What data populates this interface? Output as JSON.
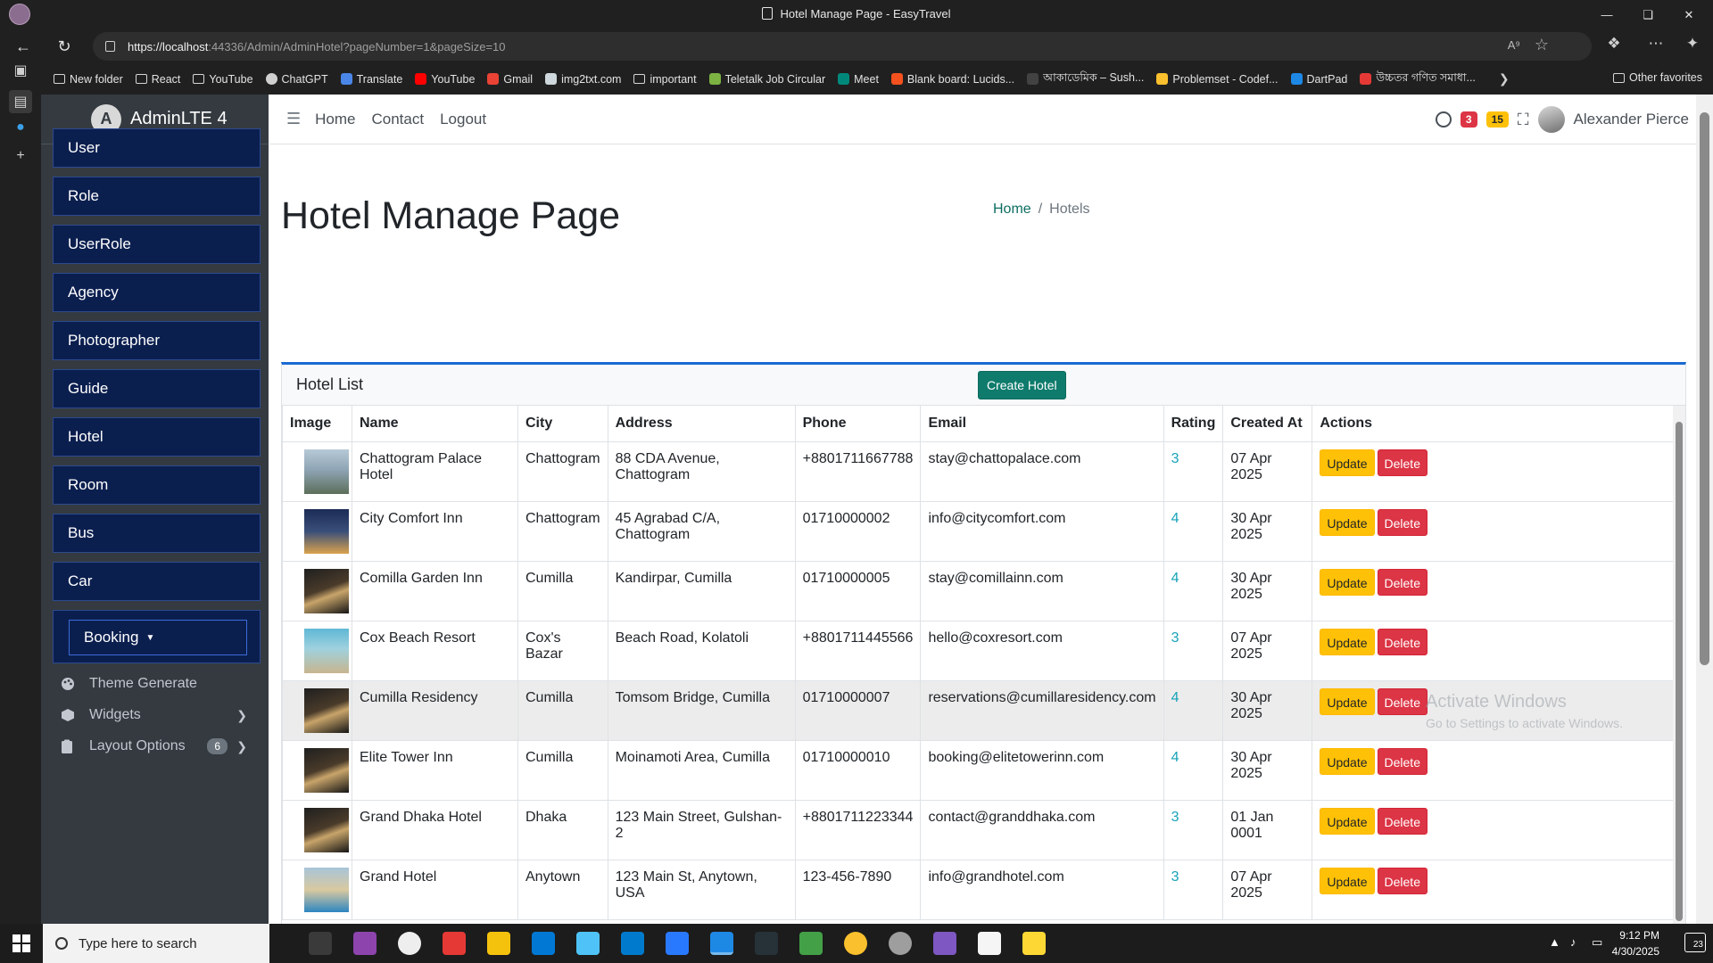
{
  "browser": {
    "window_title": "Hotel Manage Page - EasyTravel",
    "url_host": "https://localhost",
    "url_rest": ":44336/Admin/AdminHotel?pageNumber=1&pageSize=10",
    "bookmarks": [
      {
        "label": "New folder",
        "icon": "folder-icon"
      },
      {
        "label": "React",
        "icon": "folder-icon"
      },
      {
        "label": "YouTube",
        "icon": "folder-icon"
      },
      {
        "label": "ChatGPT",
        "icon": "chatgpt-icon"
      },
      {
        "label": "Translate",
        "icon": "translate-icon"
      },
      {
        "label": "YouTube",
        "icon": "youtube-icon"
      },
      {
        "label": "Gmail",
        "icon": "gmail-icon"
      },
      {
        "label": "img2txt.com",
        "icon": "page-icon"
      },
      {
        "label": "important",
        "icon": "folder-icon"
      },
      {
        "label": "Teletalk Job Circular",
        "icon": "teletalk-icon"
      },
      {
        "label": "Meet",
        "icon": "meet-icon"
      },
      {
        "label": "Blank board: Lucids...",
        "icon": "lucid-icon"
      },
      {
        "label": "আকাডেমিক – Sush...",
        "icon": "page-icon"
      },
      {
        "label": "Problemset - Codef...",
        "icon": "codeforces-icon"
      },
      {
        "label": "DartPad",
        "icon": "dartpad-icon"
      },
      {
        "label": "উচ্চতর গণিত সমাধা...",
        "icon": "pdf-icon"
      }
    ],
    "other_favorites": "Other favorites"
  },
  "sidebar": {
    "brand": "AdminLTE 4",
    "items": [
      "User",
      "Role",
      "UserRole",
      "Agency",
      "Photographer",
      "Guide",
      "Hotel",
      "Room",
      "Bus",
      "Car"
    ],
    "booking": "Booking",
    "sub_items": [
      {
        "label": "Theme Generate",
        "icon": "palette-icon"
      },
      {
        "label": "Widgets",
        "icon": "box-icon"
      },
      {
        "label": "Layout Options",
        "icon": "clipboard-icon",
        "badge": "6"
      }
    ]
  },
  "topnav": {
    "links": [
      "Home",
      "Contact",
      "Logout"
    ],
    "badge_red": "3",
    "badge_yellow": "15",
    "user_name": "Alexander Pierce"
  },
  "page": {
    "title": "Hotel Manage Page",
    "breadcrumb_home": "Home",
    "breadcrumb_current": "Hotels"
  },
  "card": {
    "title": "Hotel List",
    "create_label": "Create Hotel",
    "columns": [
      "Image",
      "Name",
      "City",
      "Address",
      "Phone",
      "Email",
      "Rating",
      "Created At",
      "Actions"
    ],
    "update_label": "Update",
    "delete_label": "Delete",
    "rows": [
      {
        "name": "Chattogram Palace Hotel",
        "city": "Chattogram",
        "address": "88 CDA Avenue, Chattogram",
        "phone": "+8801711667788",
        "email": "stay@chattopalace.com",
        "rating": "3",
        "created": "07 Apr 2025",
        "thumb": "tower"
      },
      {
        "name": "City Comfort Inn",
        "city": "Chattogram",
        "address": "45 Agrabad C/A, Chattogram",
        "phone": "01710000002",
        "email": "info@citycomfort.com",
        "rating": "4",
        "created": "30 Apr 2025",
        "thumb": "night"
      },
      {
        "name": "Comilla Garden Inn",
        "city": "Cumilla",
        "address": "Kandirpar, Cumilla",
        "phone": "01710000005",
        "email": "stay@comillainn.com",
        "rating": "4",
        "created": "30 Apr 2025",
        "thumb": "dark"
      },
      {
        "name": "Cox Beach Resort",
        "city": "Cox's Bazar",
        "address": "Beach Road, Kolatoli",
        "phone": "+8801711445566",
        "email": "hello@coxresort.com",
        "rating": "3",
        "created": "07 Apr 2025",
        "thumb": "beach"
      },
      {
        "name": "Cumilla Residency",
        "city": "Cumilla",
        "address": "Tomsom Bridge, Cumilla",
        "phone": "01710000007",
        "email": "reservations@cumillaresidency.com",
        "rating": "4",
        "created": "30 Apr 2025",
        "thumb": "dark"
      },
      {
        "name": "Elite Tower Inn",
        "city": "Cumilla",
        "address": "Moinamoti Area, Cumilla",
        "phone": "01710000010",
        "email": "booking@elitetowerinn.com",
        "rating": "4",
        "created": "30 Apr 2025",
        "thumb": "dark"
      },
      {
        "name": "Grand Dhaka Hotel",
        "city": "Dhaka",
        "address": "123 Main Street, Gulshan-2",
        "phone": "+8801711223344",
        "email": "contact@granddhaka.com",
        "rating": "3",
        "created": "01 Jan 0001",
        "thumb": "dark"
      },
      {
        "name": "Grand Hotel",
        "city": "Anytown",
        "address": "123 Main St, Anytown, USA",
        "phone": "123-456-7890",
        "email": "info@grandhotel.com",
        "rating": "3",
        "created": "07 Apr 2025",
        "thumb": "pool"
      }
    ]
  },
  "watermark": {
    "line1": "Activate Windows",
    "line2": "Go to Settings to activate Windows."
  },
  "taskbar": {
    "search_placeholder": "Type here to search",
    "time": "9:12 PM",
    "date": "4/30/2025",
    "notif_count": "23"
  },
  "colors": {
    "sidebar_bg": "#343a40",
    "menu_btn": "#0b1f4f",
    "accent_teal": "#0f7b6c",
    "update_btn": "#ffc107",
    "delete_btn": "#dc3545",
    "rating_link": "#17a2b8",
    "card_border": "#1a6bd2"
  }
}
